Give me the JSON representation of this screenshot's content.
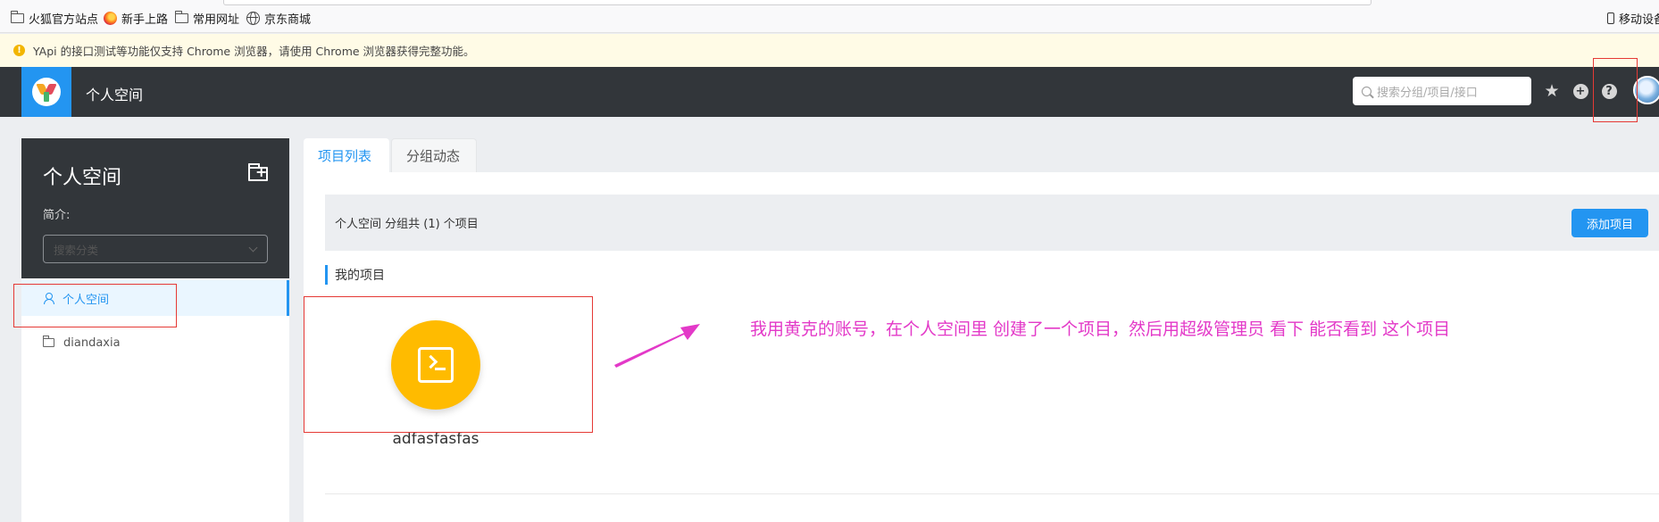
{
  "browser": {
    "bookmarks": [
      {
        "label": "火狐官方站点",
        "icon": "folder-icon"
      },
      {
        "label": "新手上路",
        "icon": "firefox-icon"
      },
      {
        "label": "常用网址",
        "icon": "folder-icon"
      },
      {
        "label": "京东商城",
        "icon": "globe-icon"
      }
    ],
    "mobile_bookmarks": "移动设备"
  },
  "warning": {
    "text": "YApi 的接口测试等功能仅支持 Chrome 浏览器，请使用 Chrome 浏览器获得完整功能。",
    "icon": "warning-icon"
  },
  "header": {
    "title": "个人空间",
    "search_placeholder": "搜索分组/项目/接口",
    "icons": [
      "star-icon",
      "plus-circle-icon",
      "help-icon",
      "avatar"
    ]
  },
  "sidebar": {
    "title": "个人空间",
    "desc_label": "简介:",
    "search_placeholder": "搜索分类",
    "items": [
      {
        "label": "个人空间",
        "icon": "user-icon",
        "active": true
      },
      {
        "label": "diandaxia",
        "icon": "folder-icon",
        "active": false
      }
    ]
  },
  "tabs": [
    {
      "label": "项目列表",
      "active": true
    },
    {
      "label": "分组动态",
      "active": false
    }
  ],
  "main": {
    "info_text": "个人空间 分组共 (1) 个项目",
    "add_button": "添加项目",
    "section_title": "我的项目",
    "projects": [
      {
        "name": "adfasfasfas",
        "icon": "terminal-icon"
      }
    ]
  },
  "annotation": {
    "text": "我用黄克的账号，在个人空间里 创建了一个项目，然后用超级管理员 看下 能否看到 这个项目"
  },
  "colors": {
    "accent": "#2395f1",
    "header_bg": "#32363a",
    "project_icon_bg": "#ffbb00",
    "annotation": "#e339c8",
    "highlight_box": "#e53935"
  }
}
